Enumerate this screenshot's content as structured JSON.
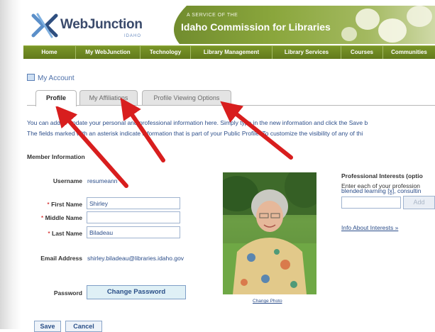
{
  "header": {
    "logo_text": "WebJunction",
    "logo_sub": "IDAHO",
    "service_of": "A SERVICE OF THE",
    "commission": "Idaho Commission for Libraries"
  },
  "nav": [
    "Home",
    "My WebJunction",
    "Technology",
    "Library Management",
    "Library Services",
    "Courses",
    "Communities"
  ],
  "page_title": "My Account",
  "tabs": [
    "Profile",
    "My Affiliations",
    "Profile Viewing Options"
  ],
  "intro": {
    "line1": "You can add or update your personal and professional information here. Simply type in the new information and click the Save b",
    "line2": "The fields marked with an asterisk indicate information that is part of your Public Profile. To customize the visibility of any of thi"
  },
  "member": {
    "heading": "Member Information",
    "username_label": "Username",
    "username": "resumeann",
    "first_name_label": "First Name",
    "first_name": "Shirley",
    "middle_name_label": "Middle Name",
    "middle_name": "",
    "last_name_label": "Last Name",
    "last_name": "Biladeau",
    "email_label": "Email Address",
    "email": "shirley.biladeau@libraries.idaho.gov",
    "password_label": "Password",
    "change_password": "Change Password",
    "required_mark": "*"
  },
  "photo": {
    "change_link": "Change Photo"
  },
  "interests": {
    "heading": "Professional Interests (optio",
    "instructions": "Enter each of your profession",
    "list_text": "blended learning",
    "delete_mark": "[x]",
    "list_more": ", consultin",
    "add_label": "Add",
    "info_link": "Info About Interests »"
  },
  "actions": {
    "save": "Save",
    "cancel": "Cancel"
  },
  "colors": {
    "nav_green": "#6d8a22",
    "link_blue": "#2c4e8a",
    "arrow_red": "#d81e1e"
  }
}
